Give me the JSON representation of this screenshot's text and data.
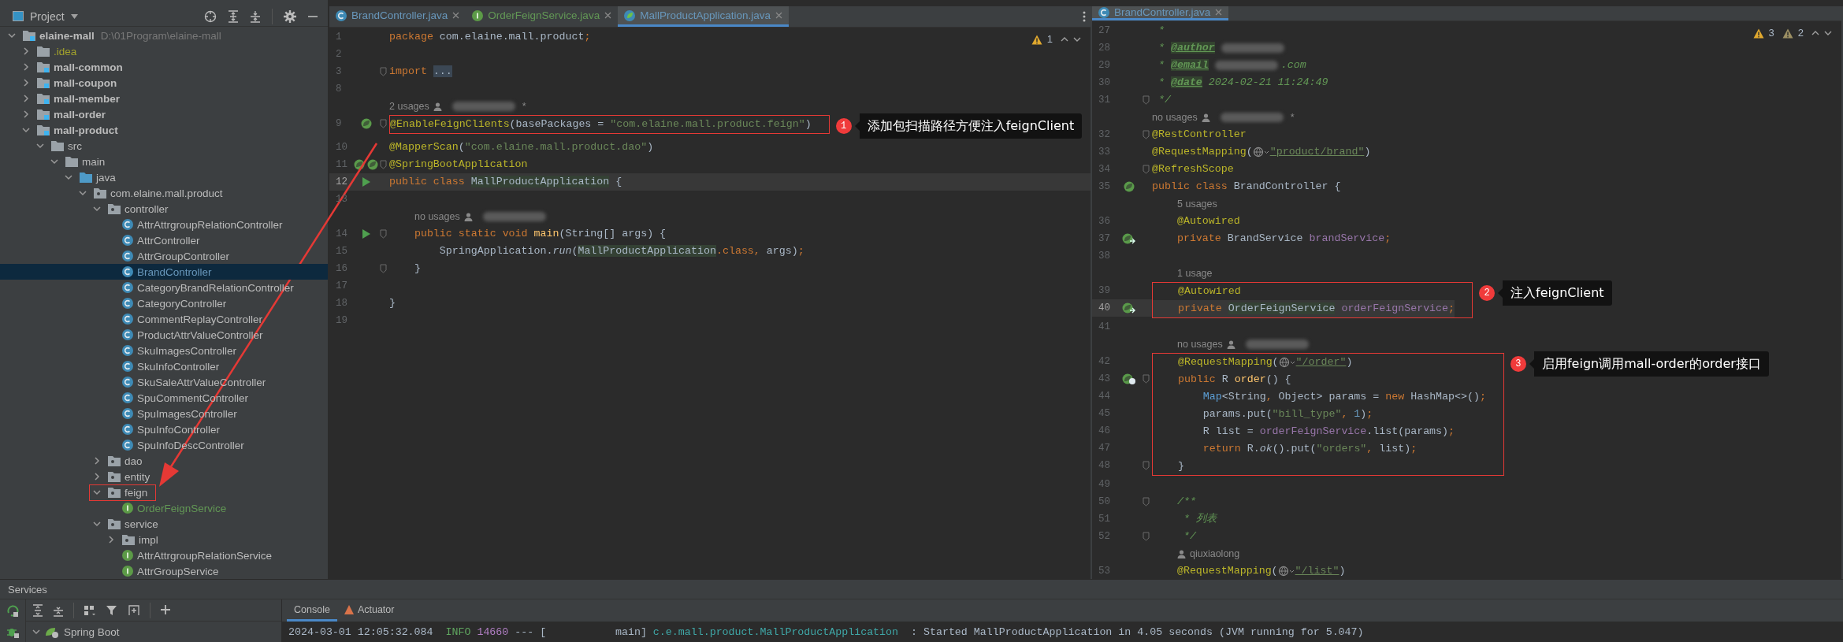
{
  "project": {
    "title": "Project",
    "tree": [
      {
        "label": "elaine-mall",
        "kind": "project",
        "path": "D:\\01Program\\elaine-mall",
        "expanded": true,
        "selected": false,
        "children": [
          {
            "label": ".idea",
            "kind": "folder",
            "color": "#a3a32c",
            "expanded": false,
            "selected": false
          },
          {
            "label": "mall-common",
            "kind": "module",
            "expanded": false,
            "selected": false
          },
          {
            "label": "mall-coupon",
            "kind": "module",
            "expanded": false,
            "selected": false
          },
          {
            "label": "mall-member",
            "kind": "module",
            "expanded": false,
            "selected": false
          },
          {
            "label": "mall-order",
            "kind": "module",
            "expanded": false,
            "selected": false
          },
          {
            "label": "mall-product",
            "kind": "module",
            "expanded": true,
            "selected": false,
            "children": [
              {
                "label": "src",
                "kind": "folder",
                "expanded": true,
                "selected": false,
                "children": [
                  {
                    "label": "main",
                    "kind": "folder",
                    "expanded": true,
                    "selected": false,
                    "children": [
                      {
                        "label": "java",
                        "kind": "source-root",
                        "expanded": true,
                        "selected": false,
                        "children": [
                          {
                            "label": "com.elaine.mall.product",
                            "kind": "package",
                            "expanded": true,
                            "selected": false,
                            "children": [
                              {
                                "label": "controller",
                                "kind": "package",
                                "expanded": true,
                                "selected": false,
                                "children": [
                                  {
                                    "label": "AttrAttrgroupRelationController",
                                    "kind": "class",
                                    "selected": false
                                  },
                                  {
                                    "label": "AttrController",
                                    "kind": "class",
                                    "selected": false
                                  },
                                  {
                                    "label": "AttrGroupController",
                                    "kind": "class",
                                    "selected": false
                                  },
                                  {
                                    "label": "BrandController",
                                    "kind": "class",
                                    "color": "#6897bb",
                                    "selected": true
                                  },
                                  {
                                    "label": "CategoryBrandRelationController",
                                    "kind": "class",
                                    "selected": false
                                  },
                                  {
                                    "label": "CategoryController",
                                    "kind": "class",
                                    "selected": false
                                  },
                                  {
                                    "label": "CommentReplayController",
                                    "kind": "class",
                                    "selected": false
                                  },
                                  {
                                    "label": "ProductAttrValueController",
                                    "kind": "class",
                                    "selected": false
                                  },
                                  {
                                    "label": "SkuImagesController",
                                    "kind": "class",
                                    "selected": false
                                  },
                                  {
                                    "label": "SkuInfoController",
                                    "kind": "class",
                                    "selected": false
                                  },
                                  {
                                    "label": "SkuSaleAttrValueController",
                                    "kind": "class",
                                    "selected": false
                                  },
                                  {
                                    "label": "SpuCommentController",
                                    "kind": "class",
                                    "selected": false
                                  },
                                  {
                                    "label": "SpuImagesController",
                                    "kind": "class",
                                    "selected": false
                                  },
                                  {
                                    "label": "SpuInfoController",
                                    "kind": "class",
                                    "selected": false
                                  },
                                  {
                                    "label": "SpuInfoDescController",
                                    "kind": "class",
                                    "selected": false
                                  }
                                ]
                              },
                              {
                                "label": "dao",
                                "kind": "package",
                                "expanded": false,
                                "selected": false
                              },
                              {
                                "label": "entity",
                                "kind": "package",
                                "expanded": false,
                                "selected": false
                              },
                              {
                                "label": "feign",
                                "kind": "package",
                                "expanded": true,
                                "highlighted": true,
                                "selected": false,
                                "children": [
                                  {
                                    "label": "OrderFeignService",
                                    "kind": "interface",
                                    "color": "#629755",
                                    "selected": false
                                  }
                                ]
                              },
                              {
                                "label": "service",
                                "kind": "package",
                                "expanded": true,
                                "selected": false,
                                "children": [
                                  {
                                    "label": "impl",
                                    "kind": "package",
                                    "expanded": false,
                                    "selected": false
                                  },
                                  {
                                    "label": "AttrAttrgroupRelationService",
                                    "kind": "interface",
                                    "selected": false
                                  },
                                  {
                                    "label": "AttrGroupService",
                                    "kind": "interface",
                                    "selected": false
                                  }
                                ]
                              }
                            ]
                          }
                        ]
                      }
                    ]
                  }
                ]
              }
            ]
          }
        ]
      }
    ]
  },
  "editors": [
    {
      "menu": true,
      "tabs": [
        {
          "label": "BrandController.java",
          "kind": "class",
          "color": "#6897bb",
          "selected": false
        },
        {
          "label": "OrderFeignService.java",
          "kind": "interface",
          "color": "#629755",
          "selected": false
        },
        {
          "label": "MallProductApplication.java",
          "kind": "app",
          "color": "#6897bb",
          "selected": true
        }
      ],
      "inspections": [
        {
          "kind": "warning",
          "count": "1"
        }
      ],
      "rows": [
        {
          "kind": "line",
          "number": "1",
          "code": [
            {
              "kind": "keyword",
              "text": "package"
            },
            {
              "kind": "plain",
              "text": " com.elaine.mall.product"
            },
            {
              "kind": "keyword",
              "text": ";"
            }
          ]
        },
        {
          "kind": "line",
          "number": "2",
          "code": []
        },
        {
          "kind": "line",
          "number": "3",
          "fold": true,
          "code": [
            {
              "kind": "keyword",
              "text": "import "
            },
            {
              "kind": "folded",
              "text": "..."
            }
          ]
        },
        {
          "kind": "line",
          "number": "8",
          "code": []
        },
        {
          "kind": "hint",
          "code": [
            {
              "kind": "hint",
              "text": "2 usages"
            },
            {
              "kind": "person"
            },
            {
              "kind": "blur"
            },
            {
              "kind": "hint",
              "text": "*"
            }
          ]
        },
        {
          "kind": "box",
          "note": {
            "number": "1",
            "text": "添加包扫描路径方便注入feignClient"
          },
          "rows": [
            {
              "kind": "line",
              "number": "9",
              "gutter": {
                "kind": "bean"
              },
              "fold": true,
              "code": [
                {
                  "kind": "annotation",
                  "text": "@EnableFeignClients"
                },
                {
                  "kind": "plain",
                  "text": "(basePackages = "
                },
                {
                  "kind": "string",
                  "text": "\"com.elaine.mall.product.feign\""
                },
                {
                  "kind": "plain",
                  "text": ")"
                }
              ]
            }
          ]
        },
        {
          "kind": "line",
          "number": "10",
          "code": [
            {
              "kind": "annotation",
              "text": "@MapperScan"
            },
            {
              "kind": "plain",
              "text": "("
            },
            {
              "kind": "string",
              "text": "\"com.elaine.mall.product.dao\""
            },
            {
              "kind": "plain",
              "text": ")"
            }
          ]
        },
        {
          "kind": "line",
          "number": "11",
          "gutter": {
            "kind": "beans"
          },
          "fold": true,
          "code": [
            {
              "kind": "annotation",
              "text": "@SpringBootApplication"
            }
          ]
        },
        {
          "kind": "line",
          "number": "12",
          "gutter": {
            "kind": "run"
          },
          "current": true,
          "code": [
            {
              "kind": "keyword",
              "text": "public class "
            },
            {
              "kind": "type",
              "text": "MallProductApplication"
            },
            {
              "kind": "plain",
              "text": " {"
            }
          ]
        },
        {
          "kind": "line",
          "number": "13",
          "code": []
        },
        {
          "kind": "member-hint",
          "code": [
            {
              "kind": "hint",
              "text": "no usages"
            },
            {
              "kind": "person"
            },
            {
              "kind": "blur"
            }
          ]
        },
        {
          "kind": "line",
          "number": "14",
          "gutter": {
            "kind": "run"
          },
          "fold": true,
          "code": [
            {
              "kind": "keyword",
              "text": "    public static void "
            },
            {
              "kind": "method",
              "text": "main"
            },
            {
              "kind": "plain",
              "text": "(String[] args) {"
            }
          ]
        },
        {
          "kind": "line",
          "number": "15",
          "code": [
            {
              "kind": "plain",
              "text": "        SpringApplication."
            },
            {
              "kind": "italic",
              "text": "run"
            },
            {
              "kind": "plain",
              "text": "("
            },
            {
              "kind": "type",
              "text": "MallProductApplication"
            },
            {
              "kind": "keyword",
              "text": ".class, "
            },
            {
              "kind": "plain",
              "text": "args)"
            },
            {
              "kind": "keyword",
              "text": ";"
            }
          ]
        },
        {
          "kind": "line",
          "number": "16",
          "fold": true,
          "code": [
            {
              "kind": "plain",
              "text": "    }"
            }
          ]
        },
        {
          "kind": "line",
          "number": "17",
          "code": []
        },
        {
          "kind": "line",
          "number": "18",
          "code": [
            {
              "kind": "plain",
              "text": "}"
            }
          ]
        },
        {
          "kind": "line",
          "number": "19",
          "code": []
        }
      ]
    },
    {
      "tabs": [
        {
          "label": "BrandController.java",
          "kind": "class",
          "color": "#6897bb",
          "selected": true
        }
      ],
      "inspections": [
        {
          "kind": "warning",
          "count": "3"
        },
        {
          "kind": "weak-warning",
          "count": "2"
        }
      ],
      "rows": [
        {
          "kind": "line",
          "number": "27",
          "code": [
            {
              "kind": "comment",
              "text": " *"
            }
          ]
        },
        {
          "kind": "line",
          "number": "28",
          "code": [
            {
              "kind": "comment",
              "text": " * "
            },
            {
              "kind": "doctag",
              "text": "@author"
            },
            {
              "kind": "blur"
            }
          ]
        },
        {
          "kind": "line",
          "number": "29",
          "code": [
            {
              "kind": "comment",
              "text": " * "
            },
            {
              "kind": "doctag",
              "text": "@email"
            },
            {
              "kind": "blur"
            },
            {
              "kind": "comment",
              "text": ".com"
            }
          ]
        },
        {
          "kind": "line",
          "number": "30",
          "code": [
            {
              "kind": "comment",
              "text": " * "
            },
            {
              "kind": "doctag",
              "text": "@date"
            },
            {
              "kind": "comment",
              "text": " 2024-02-21 11:24:49"
            }
          ]
        },
        {
          "kind": "line",
          "number": "31",
          "fold": true,
          "code": [
            {
              "kind": "comment",
              "text": " */"
            }
          ]
        },
        {
          "kind": "hint",
          "code": [
            {
              "kind": "hint",
              "text": "no usages"
            },
            {
              "kind": "person"
            },
            {
              "kind": "blur"
            },
            {
              "kind": "hint",
              "text": "*"
            }
          ]
        },
        {
          "kind": "line",
          "number": "32",
          "fold": true,
          "code": [
            {
              "kind": "annotation",
              "text": "@RestController"
            }
          ]
        },
        {
          "kind": "line",
          "number": "33",
          "code": [
            {
              "kind": "annotation",
              "text": "@RequestMapping"
            },
            {
              "kind": "plain",
              "text": "("
            },
            {
              "kind": "globe"
            },
            {
              "kind": "link",
              "text": "\"product/brand\""
            },
            {
              "kind": "plain",
              "text": ")"
            }
          ]
        },
        {
          "kind": "line",
          "number": "34",
          "fold": true,
          "code": [
            {
              "kind": "annotation",
              "text": "@RefreshScope"
            }
          ]
        },
        {
          "kind": "line",
          "number": "35",
          "gutter": {
            "kind": "bean"
          },
          "code": [
            {
              "kind": "keyword",
              "text": "public class "
            },
            {
              "kind": "plain",
              "text": "BrandController {"
            }
          ]
        },
        {
          "kind": "member-hint",
          "code": [
            {
              "kind": "hint",
              "text": "5 usages"
            }
          ]
        },
        {
          "kind": "line",
          "number": "36",
          "code": [
            {
              "kind": "annotation",
              "text": "    @Autowired"
            }
          ]
        },
        {
          "kind": "line",
          "number": "37",
          "gutter": {
            "kind": "bean-arrow"
          },
          "code": [
            {
              "kind": "keyword",
              "text": "    private "
            },
            {
              "kind": "plain",
              "text": "BrandService "
            },
            {
              "kind": "field",
              "text": "brandService"
            },
            {
              "kind": "keyword",
              "text": ";"
            }
          ]
        },
        {
          "kind": "line",
          "number": "38",
          "code": []
        },
        {
          "kind": "member-hint",
          "code": [
            {
              "kind": "hint",
              "text": "1 usage"
            }
          ]
        },
        {
          "kind": "box",
          "note": {
            "number": "2",
            "text": "注入feignClient"
          },
          "rows": [
            {
              "kind": "line",
              "number": "39",
              "code": [
                {
                  "kind": "annotation",
                  "text": "    @Autowired"
                }
              ]
            },
            {
              "kind": "line",
              "number": "40",
              "gutter": {
                "kind": "bean-arrow"
              },
              "current": true,
              "code": [
                {
                  "kind": "keyword",
                  "text": "    private "
                },
                {
                  "kind": "type",
                  "text": "OrderFeignService"
                },
                {
                  "kind": "field",
                  "text": " orderFeignService"
                },
                {
                  "kind": "keyword",
                  "text": ";"
                }
              ]
            }
          ]
        },
        {
          "kind": "line",
          "number": "41",
          "code": []
        },
        {
          "kind": "member-hint",
          "code": [
            {
              "kind": "hint",
              "text": "no usages"
            },
            {
              "kind": "person"
            },
            {
              "kind": "blur"
            }
          ]
        },
        {
          "kind": "box",
          "note": {
            "number": "3",
            "text": "启用feign调用mall-order的order接口"
          },
          "rows": [
            {
              "kind": "line",
              "number": "42",
              "code": [
                {
                  "kind": "annotation",
                  "text": "    @RequestMapping"
                },
                {
                  "kind": "plain",
                  "text": "("
                },
                {
                  "kind": "globe"
                },
                {
                  "kind": "link",
                  "text": "\"/order\""
                },
                {
                  "kind": "plain",
                  "text": ")"
                }
              ]
            },
            {
              "kind": "line",
              "number": "43",
              "gutter": {
                "kind": "bean-globe"
              },
              "fold": true,
              "code": [
                {
                  "kind": "keyword",
                  "text": "    public "
                },
                {
                  "kind": "plain",
                  "text": "R "
                },
                {
                  "kind": "method",
                  "text": "order"
                },
                {
                  "kind": "plain",
                  "text": "() {"
                }
              ]
            },
            {
              "kind": "line",
              "number": "44",
              "code": [
                {
                  "kind": "blue",
                  "text": "        Map"
                },
                {
                  "kind": "plain",
                  "text": "<String"
                },
                {
                  "kind": "keyword",
                  "text": ","
                },
                {
                  "kind": "plain",
                  "text": " Object> params = "
                },
                {
                  "kind": "keyword",
                  "text": "new "
                },
                {
                  "kind": "plain",
                  "text": "HashMap<>()"
                },
                {
                  "kind": "keyword",
                  "text": ";"
                }
              ]
            },
            {
              "kind": "line",
              "number": "45",
              "code": [
                {
                  "kind": "plain",
                  "text": "        params.put("
                },
                {
                  "kind": "string",
                  "text": "\"bill_type\""
                },
                {
                  "kind": "keyword",
                  "text": ", "
                },
                {
                  "kind": "number",
                  "text": "1"
                },
                {
                  "kind": "plain",
                  "text": ")"
                },
                {
                  "kind": "keyword",
                  "text": ";"
                }
              ]
            },
            {
              "kind": "line",
              "number": "46",
              "code": [
                {
                  "kind": "plain",
                  "text": "        R list = "
                },
                {
                  "kind": "field",
                  "text": "orderFeignService"
                },
                {
                  "kind": "plain",
                  "text": ".list(params)"
                },
                {
                  "kind": "keyword",
                  "text": ";"
                }
              ]
            },
            {
              "kind": "line",
              "number": "47",
              "code": [
                {
                  "kind": "keyword",
                  "text": "        return "
                },
                {
                  "kind": "plain",
                  "text": "R."
                },
                {
                  "kind": "italic",
                  "text": "ok"
                },
                {
                  "kind": "plain",
                  "text": "().put("
                },
                {
                  "kind": "string",
                  "text": "\"orders\""
                },
                {
                  "kind": "keyword",
                  "text": ", "
                },
                {
                  "kind": "plain",
                  "text": "list)"
                },
                {
                  "kind": "keyword",
                  "text": ";"
                }
              ]
            },
            {
              "kind": "line",
              "number": "48",
              "fold": true,
              "code": [
                {
                  "kind": "plain",
                  "text": "    }"
                }
              ]
            }
          ]
        },
        {
          "kind": "line",
          "number": "49",
          "code": []
        },
        {
          "kind": "line",
          "number": "50",
          "fold": true,
          "code": [
            {
              "kind": "comment",
              "text": "    /**"
            }
          ]
        },
        {
          "kind": "line",
          "number": "51",
          "code": [
            {
              "kind": "comment",
              "text": "     * 列表"
            }
          ]
        },
        {
          "kind": "line",
          "number": "52",
          "fold": true,
          "code": [
            {
              "kind": "comment",
              "text": "     */"
            }
          ]
        },
        {
          "kind": "member-hint",
          "code": [
            {
              "kind": "person"
            },
            {
              "kind": "hint",
              "text": "qiuxiaolong"
            }
          ]
        },
        {
          "kind": "line",
          "number": "53",
          "code": [
            {
              "kind": "annotation",
              "text": "    @RequestMapping"
            },
            {
              "kind": "plain",
              "text": "("
            },
            {
              "kind": "globe"
            },
            {
              "kind": "link",
              "text": "\"/list\""
            },
            {
              "kind": "plain",
              "text": ")"
            }
          ]
        }
      ]
    }
  ],
  "services": {
    "title": "Services",
    "tree": [
      {
        "label": "Spring Boot",
        "expanded": true,
        "selected": false
      }
    ],
    "tabs": [
      {
        "label": "Console",
        "kind": "console",
        "selected": true
      },
      {
        "label": "Actuator",
        "kind": "actuator",
        "selected": false
      }
    ],
    "console": [
      {
        "kind": "plain",
        "text": "2024-03-01 12:05:32.084  "
      },
      {
        "kind": "level",
        "text": "INFO"
      },
      {
        "kind": "pid",
        "text": " 14660"
      },
      {
        "kind": "plain",
        "text": " --- [           main] "
      },
      {
        "kind": "logger",
        "text": "c.e.mall.product.MallProductApplication"
      },
      {
        "kind": "plain",
        "text": "  : Started MallProductApplication in 4.05 seconds (JVM running for 5.047)"
      }
    ]
  }
}
